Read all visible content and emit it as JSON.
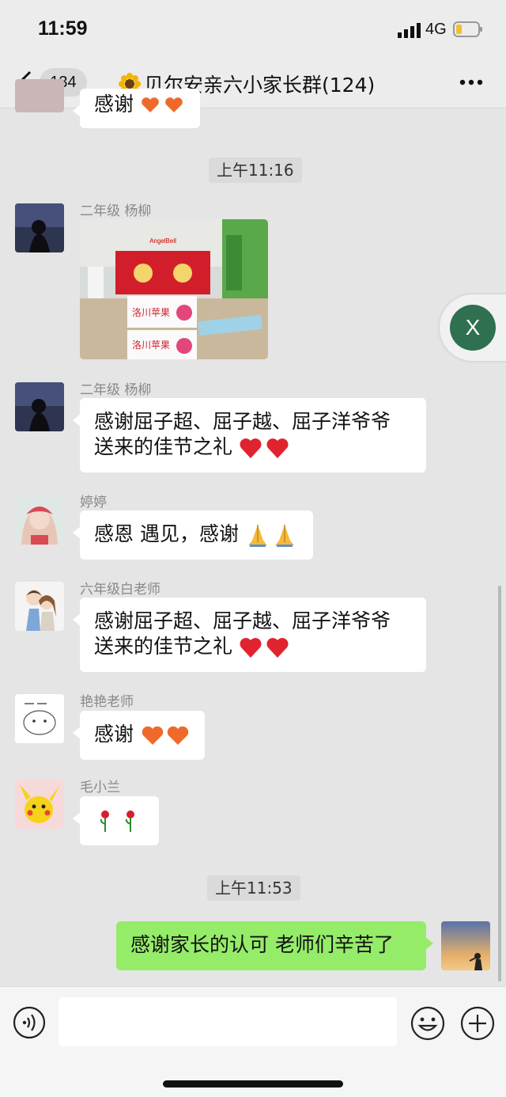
{
  "status_bar": {
    "time": "11:59",
    "network": "4G",
    "battery_icon": "battery-low-icon",
    "battery_color": "#f2c12e"
  },
  "nav": {
    "back_icon": "chevron-left-icon",
    "unread_count": "134",
    "title": "贝尔安亲六小家长群(124)",
    "title_icon": "sunflower-icon",
    "more_icon": "more-dots-icon"
  },
  "messages": [
    {
      "type": "text",
      "text": "感谢"
    },
    {
      "type": "timestamp",
      "text": "上午11:16"
    },
    {
      "type": "image",
      "sender": "二年级 杨柳",
      "image_text": [
        "洛川苹果",
        "洛川苹果",
        "AngelBell"
      ]
    },
    {
      "type": "text",
      "sender": "二年级 杨柳",
      "lines": [
        "感谢屈子超、屈子越、屈子洋爷爷",
        "送来的佳节之礼"
      ],
      "emoji": "heart-red-icon"
    },
    {
      "type": "text",
      "sender": "婷婷",
      "text": "感恩 遇见，感谢",
      "emoji": "pray-hands-icon"
    },
    {
      "type": "text",
      "sender": "六年级白老师",
      "lines": [
        "感谢屈子超、屈子越、屈子洋爷爷",
        "送来的佳节之礼"
      ],
      "emoji": "heart-red-icon"
    },
    {
      "type": "text",
      "sender": "艳艳老师",
      "text": "感谢",
      "emoji": "heart-orange-icon"
    },
    {
      "type": "text",
      "sender": "毛小兰",
      "emoji": "rose-icon"
    },
    {
      "type": "timestamp",
      "text": "上午11:53"
    },
    {
      "type": "text",
      "self": true,
      "text": "感谢家长的认可 老师们辛苦了"
    }
  ],
  "float_button": {
    "label": "X",
    "color": "#2e7050"
  },
  "input_bar": {
    "voice_icon": "voice-icon",
    "input_value": "",
    "emoji_icon": "emoji-smile-icon",
    "plus_icon": "plus-icon"
  },
  "colors": {
    "background": "#e5e5e5",
    "self_bubble": "#95ec69",
    "other_bubble": "#ffffff"
  }
}
